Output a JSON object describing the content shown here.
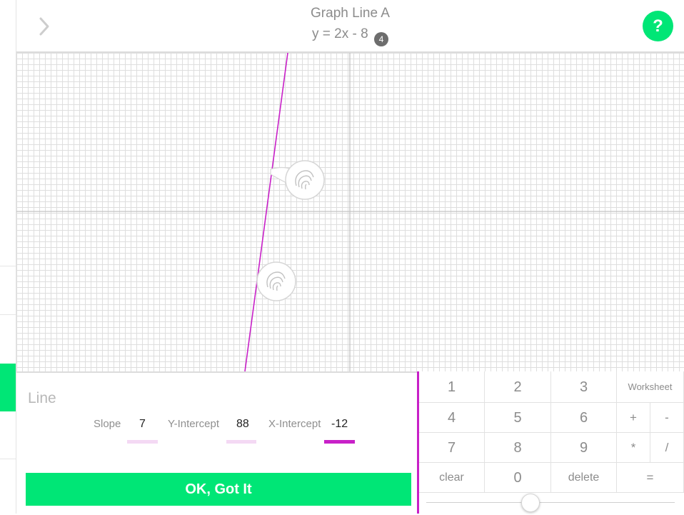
{
  "header": {
    "title": "Graph Line A",
    "equation": "y = 2x - 8",
    "badge": "4",
    "help_label": "?"
  },
  "panel": {
    "title": "Line",
    "slope_label": "Slope",
    "slope_value": "7",
    "y_intercept_label": "Y-Intercept",
    "y_intercept_value": "88",
    "x_intercept_label": "X-Intercept",
    "x_intercept_value": "-12",
    "ok_label": "OK, Got It"
  },
  "keypad": {
    "keys": [
      "1",
      "2",
      "3",
      "Worksheet",
      "4",
      "5",
      "6",
      "+",
      "-",
      "7",
      "8",
      "9",
      "*",
      "/",
      "clear",
      "0",
      "delete",
      "="
    ]
  },
  "colors": {
    "accent_green": "#00e676",
    "line_purple": "#c820c8",
    "underline_light_pink": "#f4d9f4"
  },
  "icons": {
    "back": "chevron-right-icon",
    "drag_handle": "fingerprint-icon"
  }
}
